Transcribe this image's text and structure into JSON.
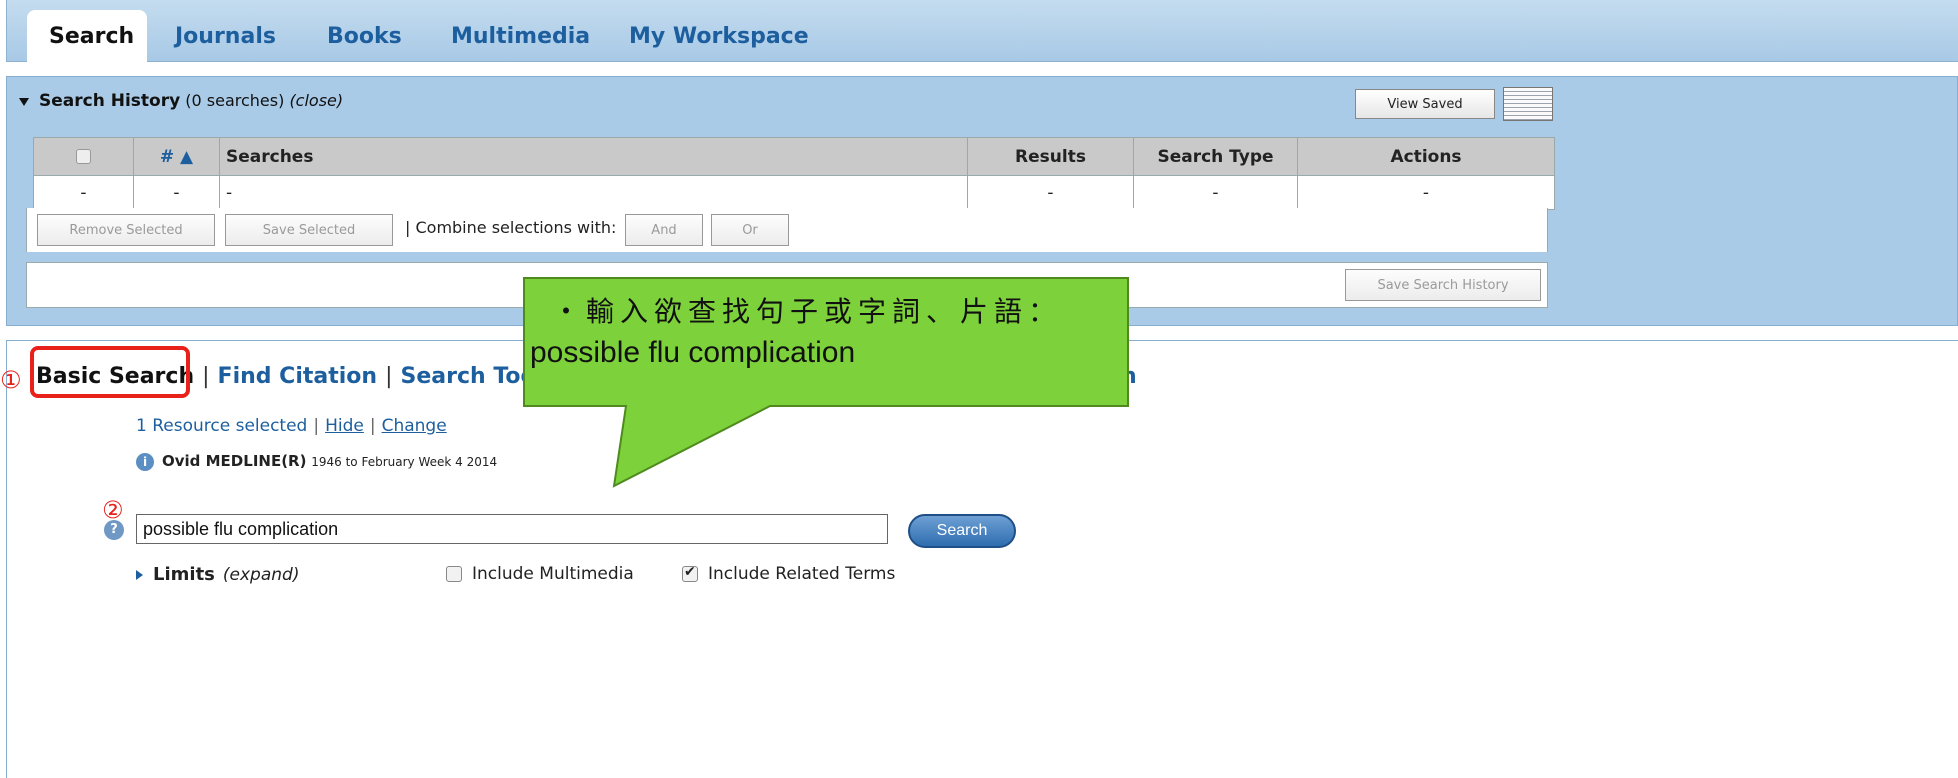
{
  "topnav": {
    "tabs": [
      {
        "label": "Search"
      },
      {
        "label": "Journals"
      },
      {
        "label": "Books"
      },
      {
        "label": "Multimedia"
      },
      {
        "label": "My Workspace"
      }
    ]
  },
  "history": {
    "title": "Search History",
    "count": "(0 searches)",
    "close": "(close)",
    "view_saved": "View Saved",
    "columns": [
      "#",
      "Searches",
      "Results",
      "Search Type",
      "Actions"
    ],
    "sort_glyph": "▲",
    "row": [
      "-",
      "-",
      "-",
      "-",
      "-",
      "-"
    ],
    "remove_selected": "Remove Selected",
    "save_selected": "Save Selected",
    "combine_label": "| Combine selections with:",
    "and": "And",
    "or": "Or",
    "save_history": "Save Search History"
  },
  "subnav": {
    "items": [
      "Basic Search",
      "Find Citation",
      "Search Tools"
    ],
    "tail": "ch"
  },
  "markers": {
    "one": "①",
    "two": "②"
  },
  "resources": {
    "selected": "1 Resource selected",
    "hide": "Hide",
    "change": "Change",
    "db_name": "Ovid MEDLINE(R)",
    "db_range": "1946 to February Week 4 2014"
  },
  "search": {
    "value": "possible flu complication",
    "button": "Search"
  },
  "limits": {
    "label": "Limits",
    "expand": "(expand)",
    "include_multimedia": "Include Multimedia",
    "include_related": "Include Related Terms"
  },
  "callout": {
    "line1": "・輸入欲查找句子或字詞、片語：",
    "line2": "possible flu complication"
  },
  "colors": {
    "accent": "#1d5f9e",
    "highlight": "#e8221b",
    "callout": "#7dd13a"
  }
}
